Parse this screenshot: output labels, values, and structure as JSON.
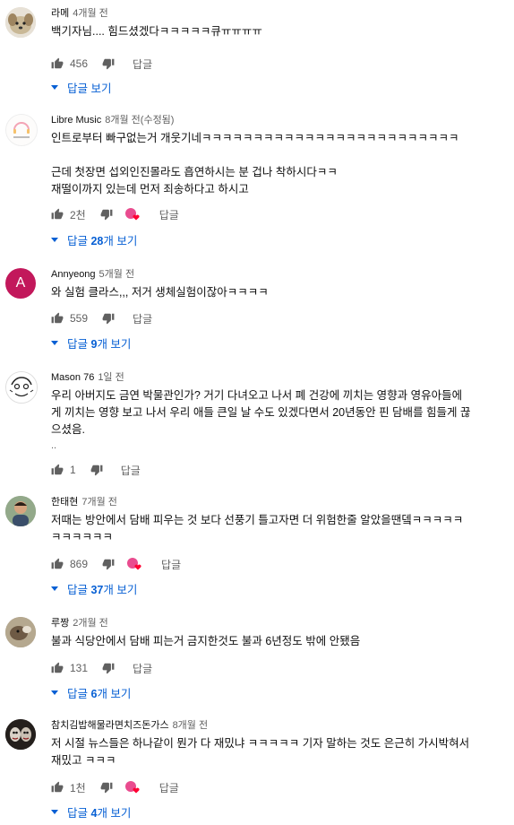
{
  "comments": [
    {
      "author": "라메",
      "time": "4개월 전",
      "text": "백기자님.... 힘드셨겠다ㅋㅋㅋㅋㅋ큐ㅠㅠㅠㅠ",
      "likes": "456",
      "reply_label": "답글",
      "replies": {
        "prefix": "답글 ",
        "count": "",
        "suffix": "보기"
      }
    },
    {
      "author": "Libre Music",
      "time": "8개월 전(수정됨)",
      "text": "인트로부터 빠구없는거 개웃기네ㅋㅋㅋㅋㅋㅋㅋㅋㅋㅋㅋㅋㅋㅋㅋㅋㅋㅋㅋㅋㅋㅋㅋㅋㅋ\n\n근데 첫장면 섭외인진몰라도 흡연하시는 분 겁나 착하시다ㅋㅋ\n재떨이까지 있는데 먼저 죄송하다고 하시고",
      "likes": "2천",
      "reply_label": "답글",
      "replies": {
        "prefix": "답글 ",
        "count": "28",
        "suffix": "개 보기"
      }
    },
    {
      "author": "Annyeong",
      "time": "5개월 전",
      "text": "와 실험 클라스,,, 저거 생체실험이잖아ㅋㅋㅋㅋ",
      "likes": "559",
      "reply_label": "답글",
      "avatar_letter": "A",
      "replies": {
        "prefix": "답글 ",
        "count": "9",
        "suffix": "개 보기"
      }
    },
    {
      "author": "Mason 76",
      "time": "1일 전",
      "text": "우리 아버지도 금연 박물관인가? 거기 다녀오고 나서 폐 건강에 끼치는 영향과 영유아들에\n게 끼치는 영향 보고 나서 우리 애들 큰일 날 수도 있겠다면서 20년동안 핀 담배를 힘들게 끊\n으셨음.",
      "ellipsis": "..",
      "likes": "1",
      "reply_label": "답글"
    },
    {
      "author": "한태현",
      "time": "7개월 전",
      "text": "저때는 방안에서 담배 피우는 것 보다 선풍기 틀고자면 더 위험한줄 알았을땐뎈ㅋㅋㅋㅋㅋ\nㅋㅋㅋㅋㅋㅋ",
      "likes": "869",
      "reply_label": "답글",
      "replies": {
        "prefix": "답글 ",
        "count": "37",
        "suffix": "개 보기"
      }
    },
    {
      "author": "루짱",
      "time": "2개월 전",
      "text": "불과 식당안에서 담배 피는거 금지한것도 불과 6년정도 밖에 안됐음",
      "likes": "131",
      "reply_label": "답글",
      "replies": {
        "prefix": "답글 ",
        "count": "6",
        "suffix": "개 보기"
      }
    },
    {
      "author": "참치김밥해물라면치즈돈가스",
      "time": "8개월 전",
      "text": "저 시절 뉴스들은 하나같이 뭔가 다 재밌냐 ㅋㅋㅋㅋㅋ 기자 말하는 것도 은근히 가시박혀서\n재밌고 ㅋㅋㅋ",
      "likes": "1천",
      "reply_label": "답글",
      "replies": {
        "prefix": "답글 ",
        "count": "4",
        "suffix": "개 보기"
      }
    }
  ],
  "colors": {
    "link": "#065fd4",
    "muted": "#606060",
    "heart": "#ff0033"
  }
}
